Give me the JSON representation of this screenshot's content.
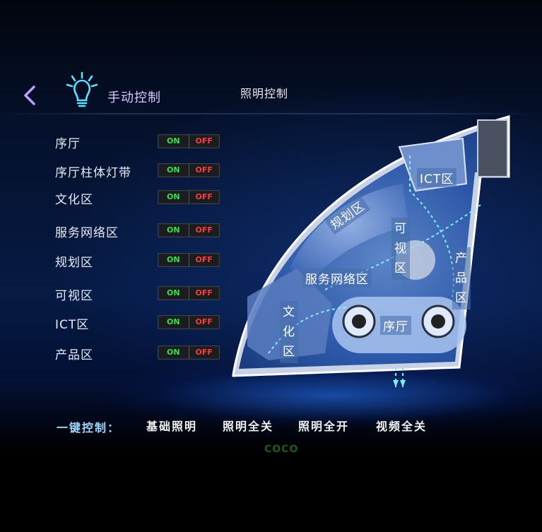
{
  "header": {
    "manual_title": "手动控制",
    "page_title": "照明控制"
  },
  "zones": [
    {
      "label": "序厅",
      "on": "ON",
      "off": "OFF"
    },
    {
      "label": "序厅柱体灯带",
      "on": "ON",
      "off": "OFF"
    },
    {
      "label": "文化区",
      "on": "ON",
      "off": "OFF"
    },
    {
      "label": "服务网络区",
      "on": "ON",
      "off": "OFF"
    },
    {
      "label": "规划区",
      "on": "ON",
      "off": "OFF"
    },
    {
      "label": "可视区",
      "on": "ON",
      "off": "OFF"
    },
    {
      "label": "ICT区",
      "on": "ON",
      "off": "OFF"
    },
    {
      "label": "产品区",
      "on": "ON",
      "off": "OFF"
    }
  ],
  "map": {
    "ict": "ICT区",
    "planning": "规划区",
    "visual": "可视区",
    "product": "产品区",
    "service": "服务网络区",
    "culture": "文化区",
    "hall": "序厅"
  },
  "bottom": {
    "title": "一键控制：",
    "buttons": [
      "基础照明",
      "照明全关",
      "照明全开",
      "视频全关"
    ]
  },
  "logo": "COCO",
  "colors": {
    "accent": "#6fd8ff",
    "on": "#35e04a",
    "off": "#ff3b3b"
  },
  "icons": {
    "back": "chevron-left-icon",
    "bulb": "lightbulb-icon"
  }
}
